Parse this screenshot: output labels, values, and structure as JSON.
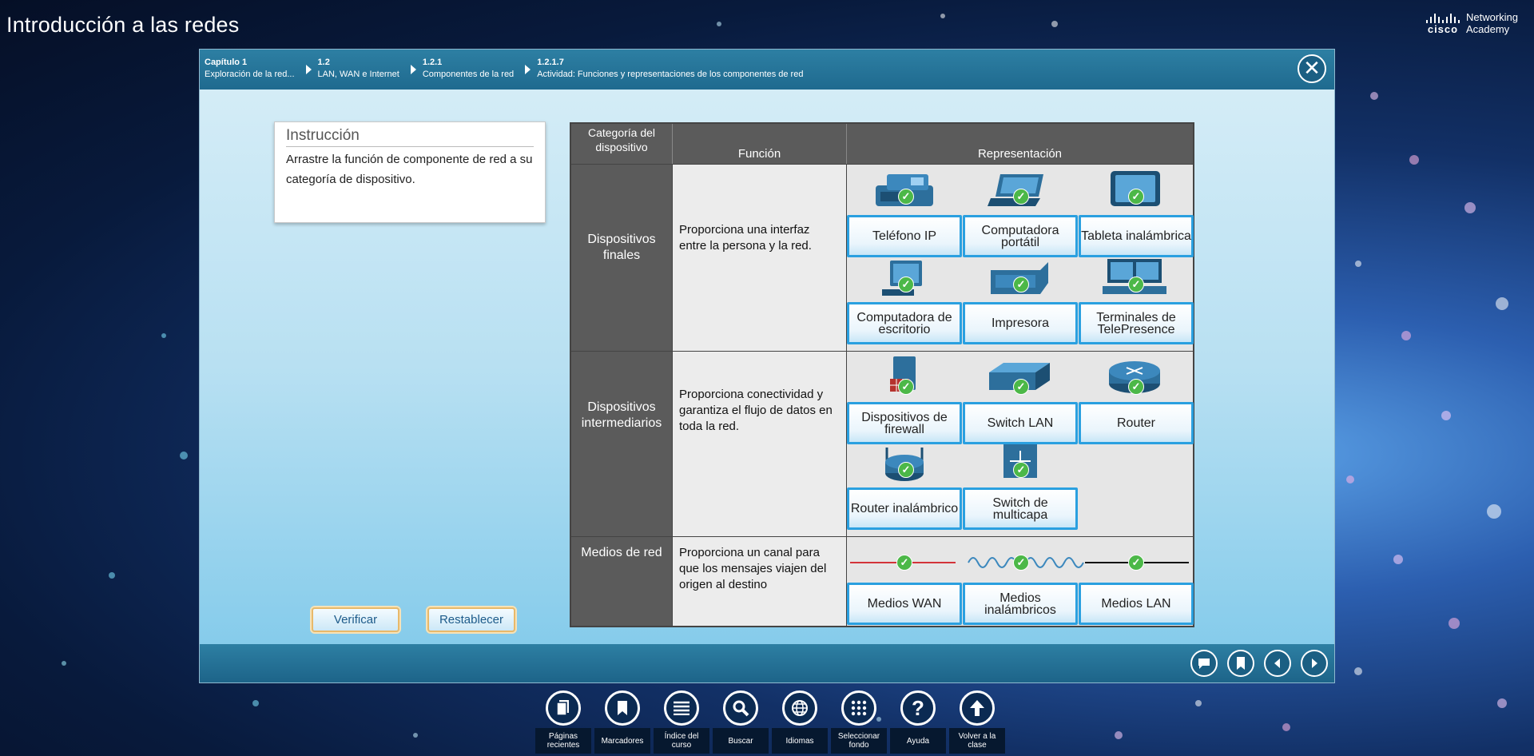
{
  "app_title": "Introducción a las redes",
  "brand": {
    "logo_word": "cisco",
    "line1": "Networking",
    "line2": "Academy"
  },
  "breadcrumbs": [
    {
      "num": "Capítulo 1",
      "label": "Exploración de la red..."
    },
    {
      "num": "1.2",
      "label": "LAN, WAN e Internet"
    },
    {
      "num": "1.2.1",
      "label": "Componentes de la red"
    },
    {
      "num": "1.2.1.7",
      "label": "Actividad: Funciones y representaciones de los componentes de red"
    }
  ],
  "close_glyph": "✕",
  "instruction": {
    "title": "Instrucción",
    "text": "Arrastre la función de componente de red a su categoría de dispositivo."
  },
  "buttons": {
    "verify": "Verificar",
    "reset": "Restablecer"
  },
  "table": {
    "headers": {
      "category": "Categoría del dispositivo",
      "function": "Función",
      "representation": "Representación"
    },
    "rows": [
      {
        "category": "Dispositivos finales",
        "function": "Proporciona una interfaz entre la persona y la red.",
        "tiles": [
          "Teléfono IP",
          "Computadora portátil",
          "Tableta inalámbrica",
          "Computadora de escritorio",
          "Impresora",
          "Terminales de TelePresence"
        ]
      },
      {
        "category": "Dispositivos intermediarios",
        "function": "Proporciona conectividad y garantiza el flujo de datos en toda la red.",
        "tiles": [
          "Dispositivos de firewall",
          "Switch LAN",
          "Router",
          "Router inalámbrico",
          "Switch de multicapa"
        ]
      },
      {
        "category": "Medios de red",
        "function": "Proporciona un canal para que los mensajes viajen del origen al destino",
        "tiles": [
          "Medios WAN",
          "Medios inalámbricos",
          "Medios LAN"
        ]
      }
    ]
  },
  "toolbar": [
    {
      "label": "Páginas recientes",
      "icon": "pages-icon"
    },
    {
      "label": "Marcadores",
      "icon": "bookmark-icon"
    },
    {
      "label": "Índice del curso",
      "icon": "list-icon"
    },
    {
      "label": "Buscar",
      "icon": "search-icon"
    },
    {
      "label": "Idiomas",
      "icon": "globe-icon"
    },
    {
      "label": "Seleccionar fondo",
      "icon": "grid-icon"
    },
    {
      "label": "Ayuda",
      "icon": "help-icon"
    },
    {
      "label": "Volver a la clase",
      "icon": "up-arrow-icon"
    }
  ],
  "colors": {
    "accent": "#2aa0e0",
    "header": "#2d7fa3",
    "category_bg": "#5b5b5b",
    "check": "#4cb848",
    "button_border": "#e8b96a"
  }
}
